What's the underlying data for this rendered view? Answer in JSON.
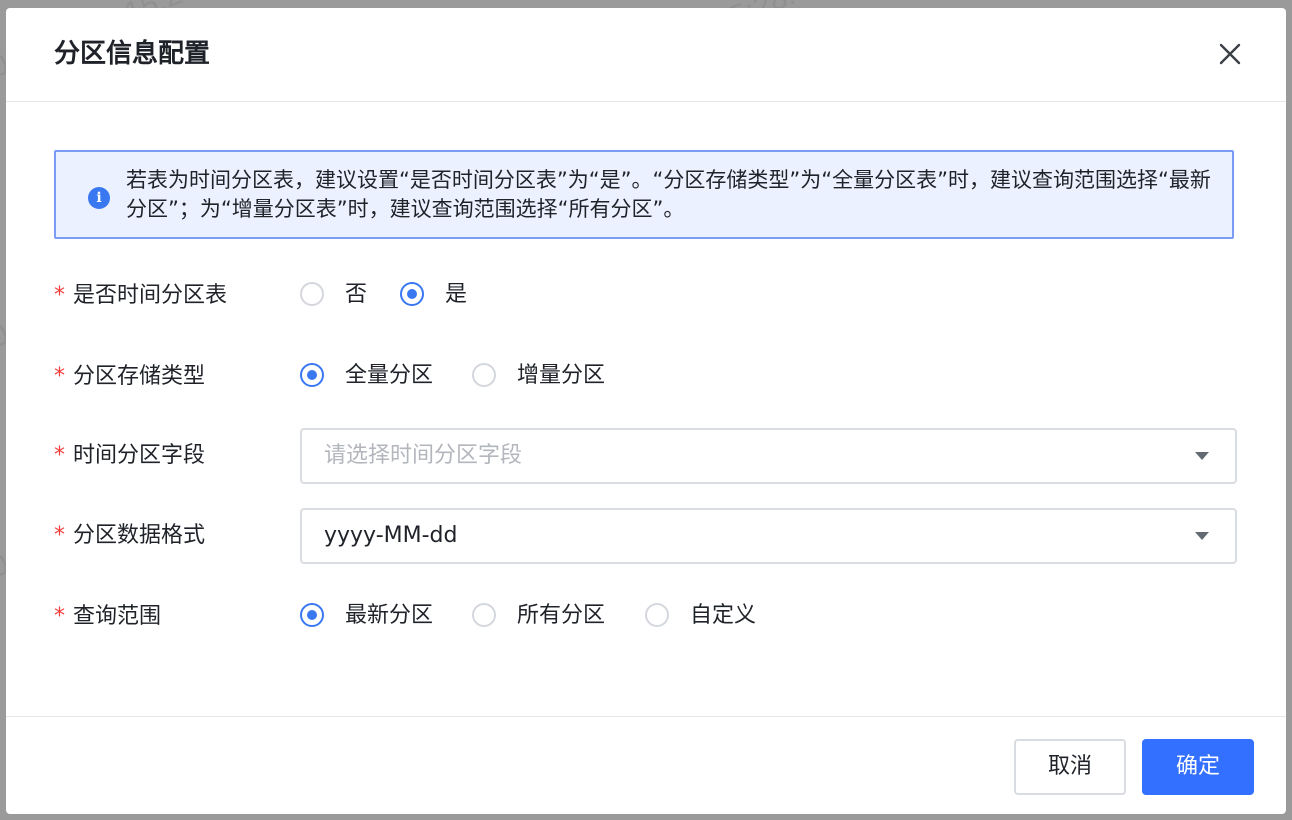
{
  "dialog": {
    "title": "分区信息配置",
    "close_icon": "close-icon"
  },
  "alert": {
    "icon": "info-icon",
    "icon_glyph": "i",
    "text": "若表为时间分区表，建议设置“是否时间分区表”为“是”。“分区存储类型”为“全量分区表”时，建议查询范围选择“最新分区”；为“增量分区表”时，建议查询范围选择“所有分区”。"
  },
  "form": {
    "required_mark": "*",
    "is_time_partition": {
      "label": "是否时间分区表",
      "options": [
        {
          "label": "否",
          "checked": false
        },
        {
          "label": "是",
          "checked": true
        }
      ]
    },
    "storage_type": {
      "label": "分区存储类型",
      "options": [
        {
          "label": "全量分区",
          "checked": true
        },
        {
          "label": "增量分区",
          "checked": false
        }
      ]
    },
    "time_field": {
      "label": "时间分区字段",
      "value": "",
      "placeholder": "请选择时间分区字段"
    },
    "data_format": {
      "label": "分区数据格式",
      "value": "yyyy-MM-dd"
    },
    "query_range": {
      "label": "查询范围",
      "options": [
        {
          "label": "最新分区",
          "checked": true
        },
        {
          "label": "所有分区",
          "checked": false
        },
        {
          "label": "自定义",
          "checked": false
        }
      ]
    }
  },
  "footer": {
    "cancel_label": "取消",
    "ok_label": "确定"
  },
  "watermark": {
    "user": "jinhanxiao",
    "timestamp": "2024-10-09 15:28:58"
  },
  "colors": {
    "primary": "#3370ff",
    "required": "#f5403d",
    "alert_bg": "#ebf1fe",
    "alert_border": "#7a9cf3"
  }
}
